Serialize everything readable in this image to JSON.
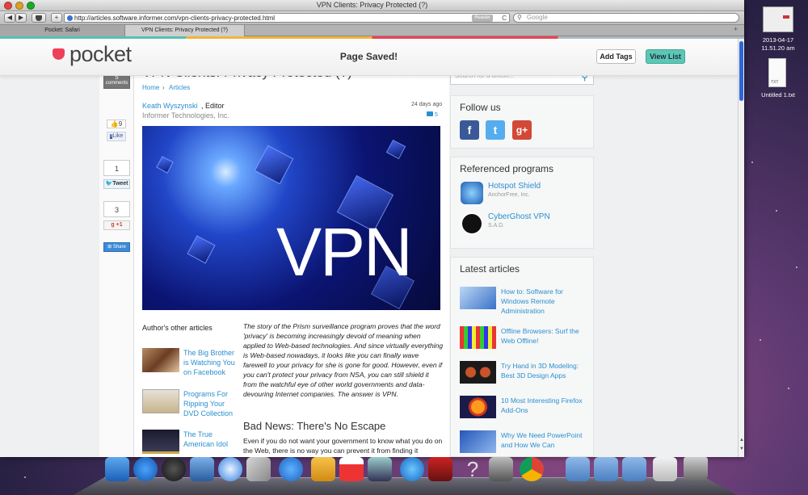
{
  "window": {
    "title": "VPN Clients: Privacy Protected (?)"
  },
  "toolbar": {
    "back": "◀",
    "forward": "▶",
    "add": "+",
    "url": "http://articles.software.informer.com/vpn-clients-privacy-protected.html",
    "reader": "Reader",
    "reload": "C",
    "search_placeholder": "Google"
  },
  "tabs": [
    {
      "label": "Pocket: Safari"
    },
    {
      "label": "VPN Clients: Privacy Protected (?)"
    }
  ],
  "pocket": {
    "logo": "pocket",
    "status": "Page Saved!",
    "add_tags": "Add Tags",
    "view_list": "View List"
  },
  "share": {
    "comments_count": "5",
    "comments_label": "comments",
    "like_count": "9",
    "like_label": "Like",
    "tweet_count": "1",
    "tweet_label": "Tweet",
    "gplus_count": "3",
    "gplus_label": "+1",
    "share_label": "Share"
  },
  "article": {
    "title": "VPN Clients: Privacy Protected (?)",
    "crumb_home": "Home",
    "crumb_sep": "›",
    "crumb_articles": "Articles",
    "author": "Keath Wyszynski",
    "role": ", Editor",
    "company": "Informer Technologies, Inc.",
    "age": "24 days ago",
    "comments": "5",
    "hero_text": "VPN",
    "other_articles_heading": "Author's other articles",
    "related": [
      {
        "title": "The Big Brother is Watching You on Facebook"
      },
      {
        "title": "Programs For Ripping Your DVD Collection"
      },
      {
        "title": "The True American Idol"
      }
    ],
    "intro": "The story of the Prism surveillance program proves that the word 'privacy' is becoming increasingly devoid of meaning when applied to Web-based technologies. And since virtually everything is Web-based nowadays, it looks like you can finally wave farewell to your privacy for she is gone for good. However, even if you can't protect your privacy from NSA, you can still shield it from the watchful eye of other world governments and data-devouring Internet companies. The answer is VPN.",
    "section_heading": "Bad News: There's No Escape",
    "section_text": "Even if you do not want your government to know what you do on the Web, there is no way you can prevent it from finding it"
  },
  "sidebar": {
    "search_placeholder": "Search for a article...",
    "follow_title": "Follow us",
    "referenced_title": "Referenced programs",
    "programs": [
      {
        "name": "Hotspot Shield",
        "publisher": "AnchorFree, Inc."
      },
      {
        "name": "CyberGhost VPN",
        "publisher": "S.A.D."
      }
    ],
    "latest_title": "Latest articles",
    "latest": [
      {
        "title": "How to: Software for Windows Remote Administration"
      },
      {
        "title": "Offline Browsers: Surf the Web Offline!"
      },
      {
        "title": "Try Hand in 3D Modeling: Best 3D Design Apps"
      },
      {
        "title": "10 Most Interesting Firefox Add-Ons"
      },
      {
        "title": "Why We Need PowerPoint and How We Can"
      }
    ]
  },
  "desktop": {
    "clock_date": "2013-04-17",
    "clock_time": "11.51.20 am",
    "file_badge": "TXT",
    "file_name": "Untitled 1.txt"
  },
  "colors": {
    "pocket_red": "#ee4056",
    "view_list": "#5dc6b4",
    "link": "#2a8fcf"
  }
}
